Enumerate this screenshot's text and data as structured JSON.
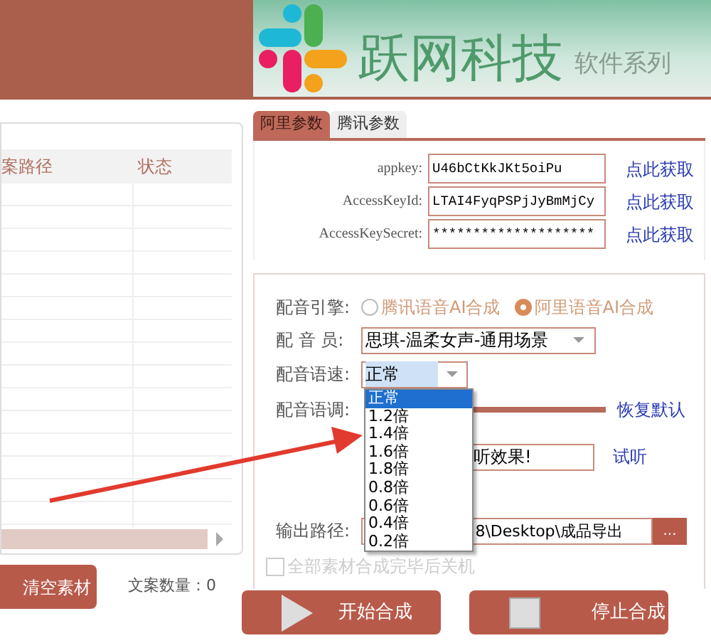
{
  "header": {
    "brand": "跃网科技",
    "subtitle": "软件系列"
  },
  "file_table": {
    "columns": [
      "案路径",
      "状态"
    ]
  },
  "clear_button": "清空素材",
  "copy_count": "文案数量：0",
  "tabs": [
    {
      "label": "阿里参数",
      "selected": true
    },
    {
      "label": "腾讯参数",
      "selected": false
    }
  ],
  "credentials": [
    {
      "label": "appkey:",
      "value": "U46bCtKkJKt5oiPu",
      "link": "点此获取"
    },
    {
      "label": "AccessKeyId:",
      "value": "LTAI4FyqPSPjJyBmMjCy",
      "link": "点此获取"
    },
    {
      "label": "AccessKeySecret:",
      "value": "********************",
      "link": "点此获取"
    }
  ],
  "engine": {
    "label": "配音引擎:",
    "options": [
      {
        "label": "腾讯语音AI合成",
        "selected": false
      },
      {
        "label": "阿里语音AI合成",
        "selected": true
      }
    ]
  },
  "voice": {
    "label": "配 音 员:",
    "value": "思琪-温柔女声-通用场景"
  },
  "speed": {
    "label": "配音语速:",
    "value": "正常",
    "options": [
      {
        "label": "正常",
        "selected": true
      },
      {
        "label": "1.2倍",
        "selected": false
      },
      {
        "label": "1.4倍",
        "selected": false
      },
      {
        "label": "1.6倍",
        "selected": false
      },
      {
        "label": "1.8倍",
        "selected": false
      },
      {
        "label": "0.8倍",
        "selected": false
      },
      {
        "label": "0.6倍",
        "selected": false
      },
      {
        "label": "0.4倍",
        "selected": false
      },
      {
        "label": "0.2倍",
        "selected": false
      }
    ]
  },
  "pitch": {
    "label": "配音语调:",
    "reset": "恢复默认"
  },
  "preview": {
    "value": "听效果!",
    "button": "试听"
  },
  "output": {
    "label": "输出路径:",
    "value": "8\\Desktop\\成品导出",
    "browse": "..."
  },
  "shutdown": {
    "label": "全部素材合成完毕后关机",
    "checked": false
  },
  "actions": [
    {
      "kind": "start",
      "label": "开始合成"
    },
    {
      "kind": "stop",
      "label": "停止合成"
    }
  ]
}
